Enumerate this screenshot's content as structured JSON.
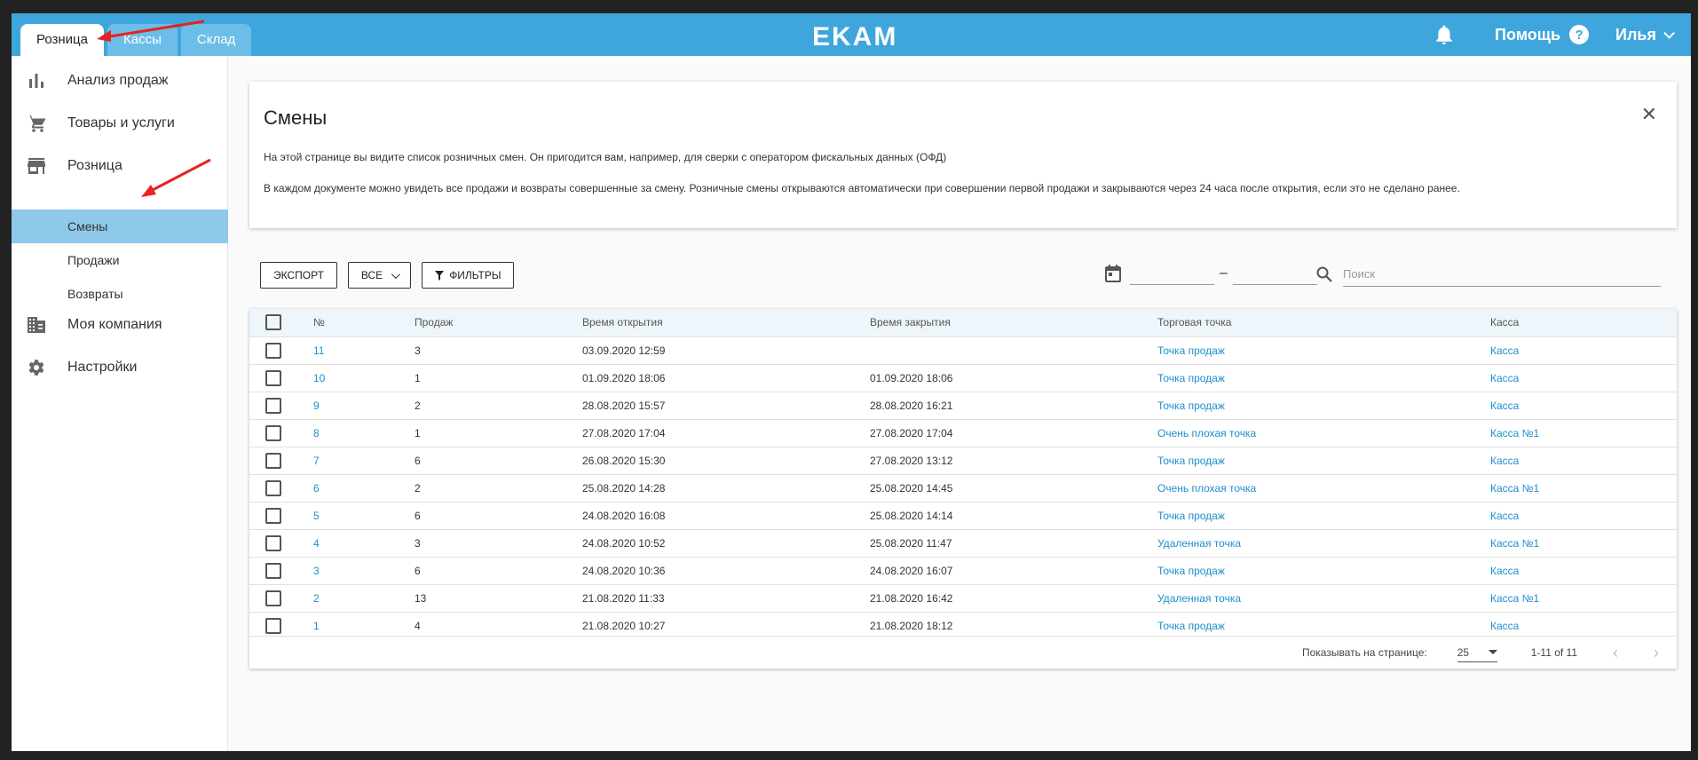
{
  "topbar": {
    "tabs": [
      "Розница",
      "Кассы",
      "Склад"
    ],
    "logo": "EKAM",
    "help_label": "Помощь",
    "help_glyph": "?",
    "user_name": "Илья"
  },
  "sidebar": {
    "items": [
      {
        "label": "Анализ продаж",
        "icon": "bar-chart-icon"
      },
      {
        "label": "Товары и услуги",
        "icon": "cart-icon"
      },
      {
        "label": "Розница",
        "icon": "store-icon"
      },
      {
        "label": "Моя компания",
        "icon": "building-icon"
      },
      {
        "label": "Настройки",
        "icon": "gear-icon"
      }
    ],
    "sub_items": [
      "Смены",
      "Продажи",
      "Возвраты"
    ]
  },
  "info_card": {
    "title": "Смены",
    "text1": "На этой странице вы видите список розничных смен. Он пригодится вам, например, для сверки с оператором фискальных данных (ОФД)",
    "text2": "В каждом документе можно увидеть все продажи и возвраты совершенные за смену. Розничные смены открываются автоматически при совершении первой продажи и закрываются через 24 часа после открытия, если это не сделано ранее.",
    "close_glyph": "✕"
  },
  "toolbar": {
    "export_label": "ЭКСПОРТ",
    "all_label": "ВСЕ",
    "filters_label": "ФИЛЬТРЫ",
    "date_dash": "–",
    "search_placeholder": "Поиск"
  },
  "table": {
    "columns": [
      "№",
      "Продаж",
      "Время открытия",
      "Время закрытия",
      "Торговая точка",
      "Касса"
    ],
    "rows": [
      [
        "11",
        "3",
        "03.09.2020 12:59",
        "",
        "Точка продаж",
        "Касса"
      ],
      [
        "10",
        "1",
        "01.09.2020 18:06",
        "01.09.2020 18:06",
        "Точка продаж",
        "Касса"
      ],
      [
        "9",
        "2",
        "28.08.2020 15:57",
        "28.08.2020 16:21",
        "Точка продаж",
        "Касса"
      ],
      [
        "8",
        "1",
        "27.08.2020 17:04",
        "27.08.2020 17:04",
        "Очень плохая точка",
        "Касса №1"
      ],
      [
        "7",
        "6",
        "26.08.2020 15:30",
        "27.08.2020 13:12",
        "Точка продаж",
        "Касса"
      ],
      [
        "6",
        "2",
        "25.08.2020 14:28",
        "25.08.2020 14:45",
        "Очень плохая точка",
        "Касса №1"
      ],
      [
        "5",
        "6",
        "24.08.2020 16:08",
        "25.08.2020 14:14",
        "Точка продаж",
        "Касса"
      ],
      [
        "4",
        "3",
        "24.08.2020 10:52",
        "25.08.2020 11:47",
        "Удаленная точка",
        "Касса №1"
      ],
      [
        "3",
        "6",
        "24.08.2020 10:36",
        "24.08.2020 16:07",
        "Точка продаж",
        "Касса"
      ],
      [
        "2",
        "13",
        "21.08.2020 11:33",
        "21.08.2020 16:42",
        "Удаленная точка",
        "Касса №1"
      ],
      [
        "1",
        "4",
        "21.08.2020 10:27",
        "21.08.2020 18:12",
        "Точка продаж",
        "Касса"
      ]
    ]
  },
  "pager": {
    "per_page_label": "Показывать на странице:",
    "per_page_value": "25",
    "range": "1-11 of 11",
    "prev_glyph": "‹",
    "next_glyph": "›"
  },
  "colors": {
    "topbar": "#3ea6dc",
    "active_sub": "#8ec9ea",
    "link": "#1e8fcc",
    "annotation_arrow": "#e8231e"
  }
}
